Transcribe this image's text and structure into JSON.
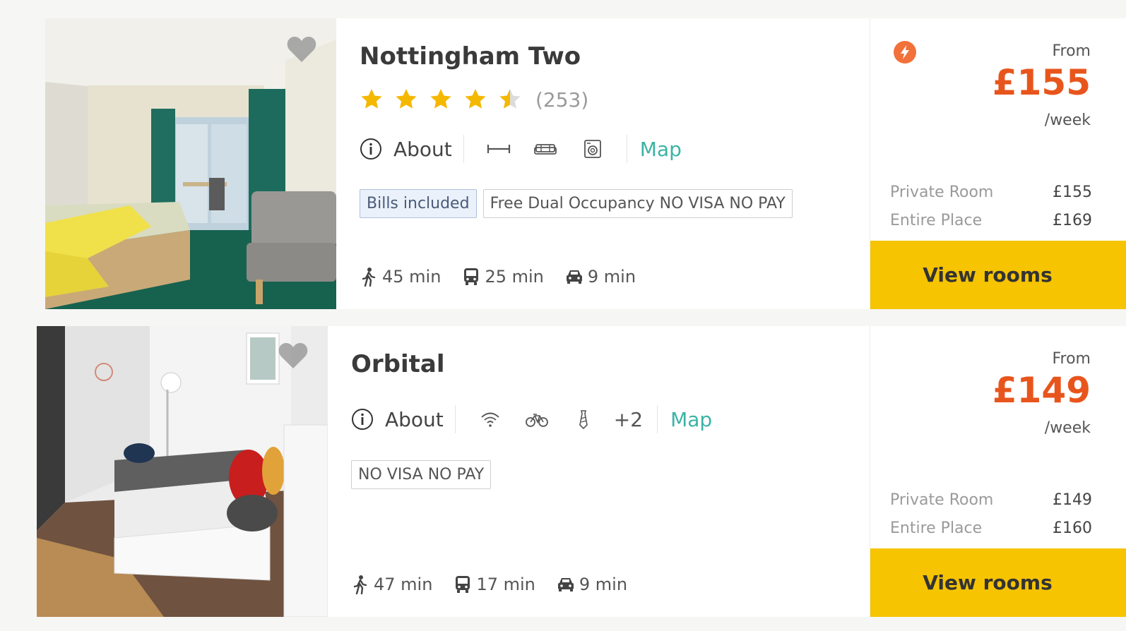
{
  "listings": [
    {
      "title": "Nottingham Two",
      "rating": 4.5,
      "reviews": "(253)",
      "about_label": "About",
      "map_label": "Map",
      "amenity_icons": [
        "ruler-icon",
        "sofa-icon",
        "washing-machine-icon"
      ],
      "tags": [
        "Bills included",
        "Free Dual Occupancy NO VISA NO PAY"
      ],
      "travel": {
        "walk": "45 min",
        "bus": "25 min",
        "car": "9 min"
      },
      "from_label": "From",
      "price": "£155",
      "per_label": "/week",
      "room_types": [
        {
          "name": "Private Room",
          "price": "£155"
        },
        {
          "name": "Entire Place",
          "price": "£169"
        }
      ],
      "button_label": "View rooms",
      "has_bolt_badge": true
    },
    {
      "title": "Orbital",
      "about_label": "About",
      "map_label": "Map",
      "amenity_icons": [
        "wifi-icon",
        "bicycle-icon",
        "tie-icon"
      ],
      "more_amenities": "+2",
      "tags": [
        "NO VISA NO PAY"
      ],
      "travel": {
        "walk": "47 min",
        "bus": "17 min",
        "car": "9 min"
      },
      "from_label": "From",
      "price": "£149",
      "per_label": "/week",
      "room_types": [
        {
          "name": "Private Room",
          "price": "£149"
        },
        {
          "name": "Entire Place",
          "price": "£160"
        }
      ],
      "button_label": "View rooms",
      "has_bolt_badge": false
    }
  ],
  "colors": {
    "price": "#e8551c",
    "button": "#f6c400",
    "map_link": "#3bb3a6",
    "star": "#f5b800",
    "bolt_badge": "#f2703a"
  }
}
